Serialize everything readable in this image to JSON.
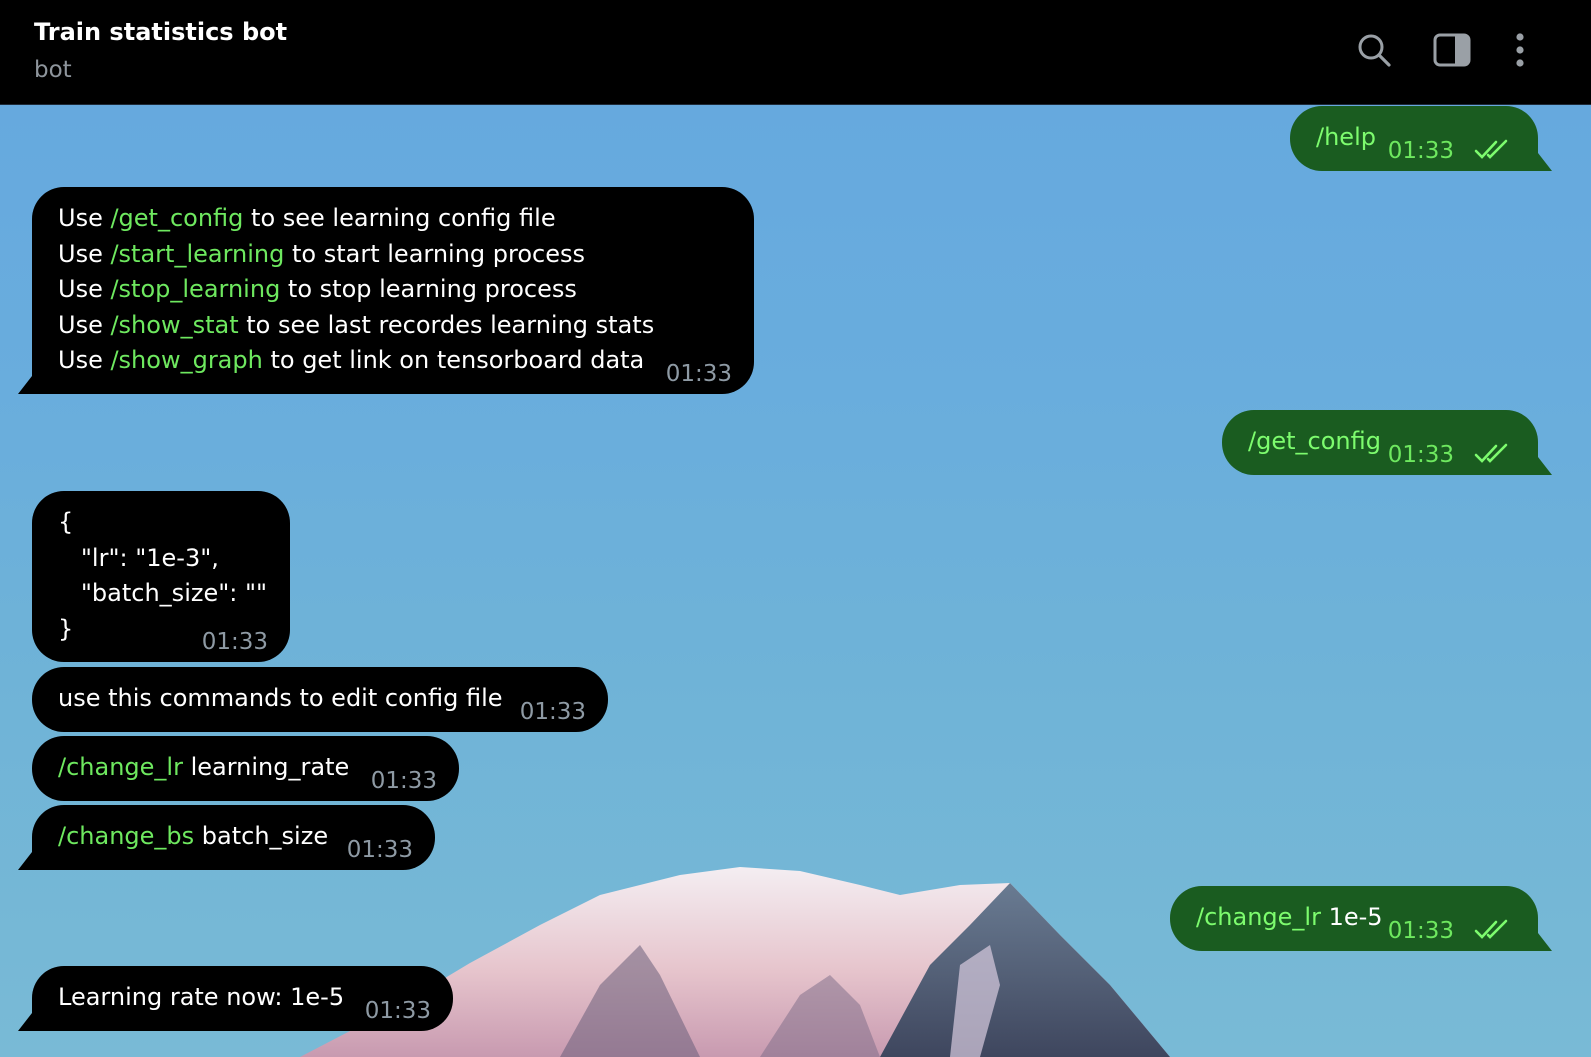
{
  "header": {
    "title": "Train statistics bot",
    "status": "bot"
  },
  "colors": {
    "incoming_bubble": "#000000",
    "outgoing_bubble": "#1a5c20",
    "command_link": "#6ee85f",
    "timestamp": "#8e9aa4"
  },
  "icons": [
    "search-icon",
    "sidebar-toggle-icon",
    "more-vertical-icon",
    "double-check-icon"
  ],
  "messages": [
    {
      "direction": "out",
      "text": "/help",
      "time": "01:33",
      "read": true
    },
    {
      "direction": "in",
      "lines": [
        {
          "pre": "Use ",
          "cmd": "/get_config",
          "post": " to see learning config file"
        },
        {
          "pre": "Use ",
          "cmd": "/start_learning",
          "post": " to start learning process"
        },
        {
          "pre": "Use ",
          "cmd": "/stop_learning",
          "post": " to stop learning process"
        },
        {
          "pre": "Use ",
          "cmd": "/show_stat",
          "post": " to see last recordes learning stats"
        },
        {
          "pre": "Use ",
          "cmd": "/show_graph",
          "post": " to get link on tensorboard data"
        }
      ],
      "time": "01:33"
    },
    {
      "direction": "out",
      "text": "/get_config",
      "time": "01:33",
      "read": true
    },
    {
      "direction": "in",
      "lines": [
        "{",
        "   \"lr\": \"1e-3\",",
        "   \"batch_size\": \"\"",
        "}"
      ],
      "time": "01:33"
    },
    {
      "direction": "in",
      "text": "use this commands to edit config file",
      "time": "01:33"
    },
    {
      "direction": "in",
      "cmd": "/change_lr",
      "post": " learning_rate",
      "time": "01:33"
    },
    {
      "direction": "in",
      "cmd": "/change_bs",
      "post": " batch_size",
      "time": "01:33"
    },
    {
      "direction": "out",
      "cmd": "/change_lr",
      "post": " 1e-5",
      "time": "01:33",
      "read": true
    },
    {
      "direction": "in",
      "text": "Learning rate now: 1e-5",
      "time": "01:33"
    }
  ]
}
